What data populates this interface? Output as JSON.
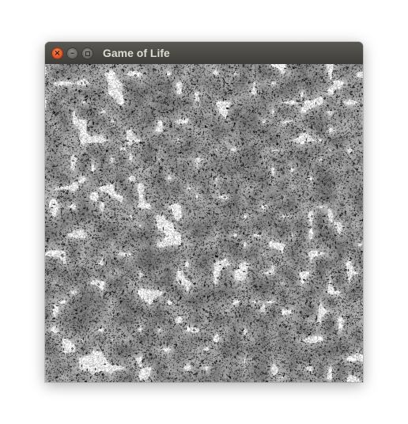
{
  "window": {
    "title": "Game of Life",
    "controls": {
      "close_icon": "close-icon",
      "minimize_icon": "minimize-icon",
      "maximize_icon": "maximize-icon"
    }
  },
  "board": {
    "cell_colors": {
      "background_grey": "#8c8c8c",
      "dark_grey": "#5e5e5e",
      "light_grey": "#b4b4b4",
      "white": "#ffffff",
      "black": "#000000"
    }
  }
}
